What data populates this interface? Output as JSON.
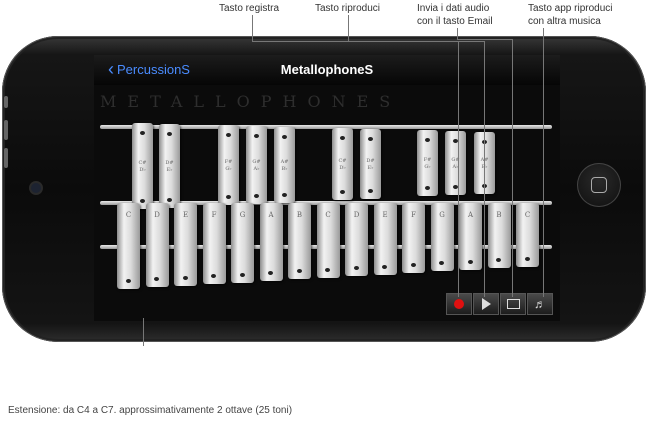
{
  "callouts": {
    "record": "Tasto registra",
    "play": "Tasto riproduci",
    "email_line1": "Invia i dati audio",
    "email_line2": "con il tasto Email",
    "music_line1": "Tasto app riproduci",
    "music_line2": "con altra musica"
  },
  "nav": {
    "back_label": "PercussionS",
    "title": "MetallophoneS"
  },
  "watermark": "METALLOPHONES",
  "white_keys": [
    "C",
    "D",
    "E",
    "F",
    "G",
    "A",
    "B",
    "C",
    "D",
    "E",
    "F",
    "G",
    "A",
    "B",
    "C"
  ],
  "sharp_keys": [
    {
      "top": "C#",
      "bottom": "D♭"
    },
    {
      "top": "D#",
      "bottom": "E♭"
    },
    {
      "top": "F#",
      "bottom": "G♭"
    },
    {
      "top": "G#",
      "bottom": "A♭"
    },
    {
      "top": "A#",
      "bottom": "B♭"
    },
    {
      "top": "C#",
      "bottom": "D♭"
    },
    {
      "top": "D#",
      "bottom": "E♭"
    },
    {
      "top": "F#",
      "bottom": "G♭"
    },
    {
      "top": "G#",
      "bottom": "A♭"
    },
    {
      "top": "A#",
      "bottom": "B♭"
    }
  ],
  "toolbar": {
    "icons": [
      "record-icon",
      "play-icon",
      "envelope-icon",
      "music-note-icon"
    ],
    "record_color": "#e01010"
  },
  "caption": "Estensione: da C4 a C7. approssimativamente 2 ottave (25 toni)"
}
